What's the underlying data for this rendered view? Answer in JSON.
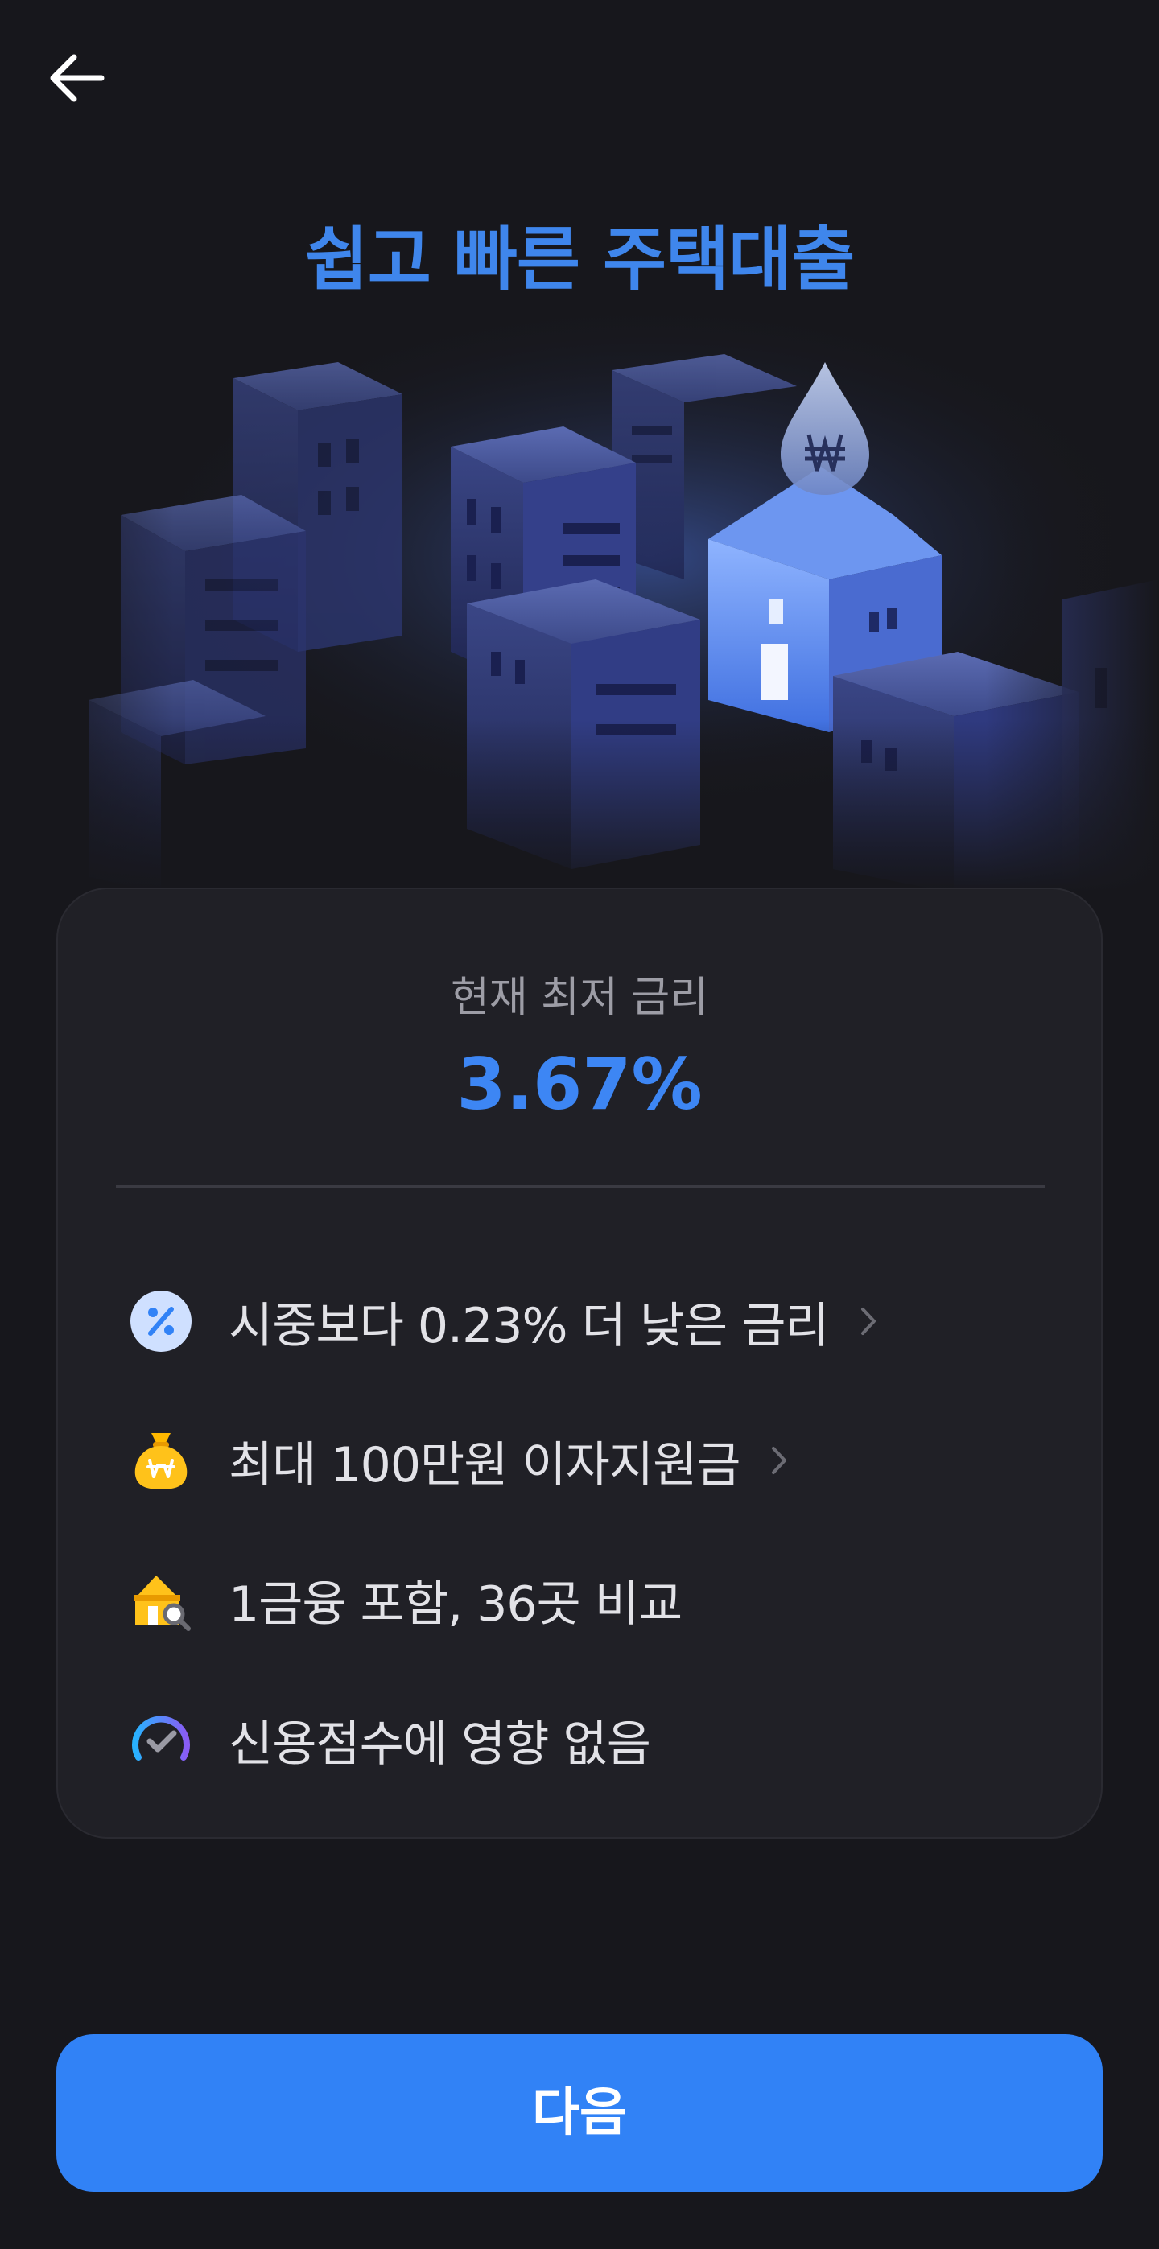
{
  "header": {
    "back_icon": "arrow-left-icon",
    "title": "쉽고 빠른 주택대출"
  },
  "hero": {
    "illustration": "night-city-house-with-won-drop"
  },
  "rate_card": {
    "label": "현재 최저 금리",
    "value": "3.67%"
  },
  "benefits": [
    {
      "icon": "percent-badge-icon",
      "text": "시중보다 0.23% 더 낮은 금리",
      "has_chevron": true
    },
    {
      "icon": "money-bag-icon",
      "text": "최대 100만원 이자지원금",
      "has_chevron": true
    },
    {
      "icon": "house-search-icon",
      "text": "1금융 포함, 36곳 비교",
      "has_chevron": false
    },
    {
      "icon": "gauge-check-icon",
      "text": "신용점수에 영향 없음",
      "has_chevron": false
    }
  ],
  "footer": {
    "next_label": "다음"
  },
  "colors": {
    "background": "#17171c",
    "card": "#202026",
    "accent": "#3182f6",
    "title": "#3f86ec"
  }
}
